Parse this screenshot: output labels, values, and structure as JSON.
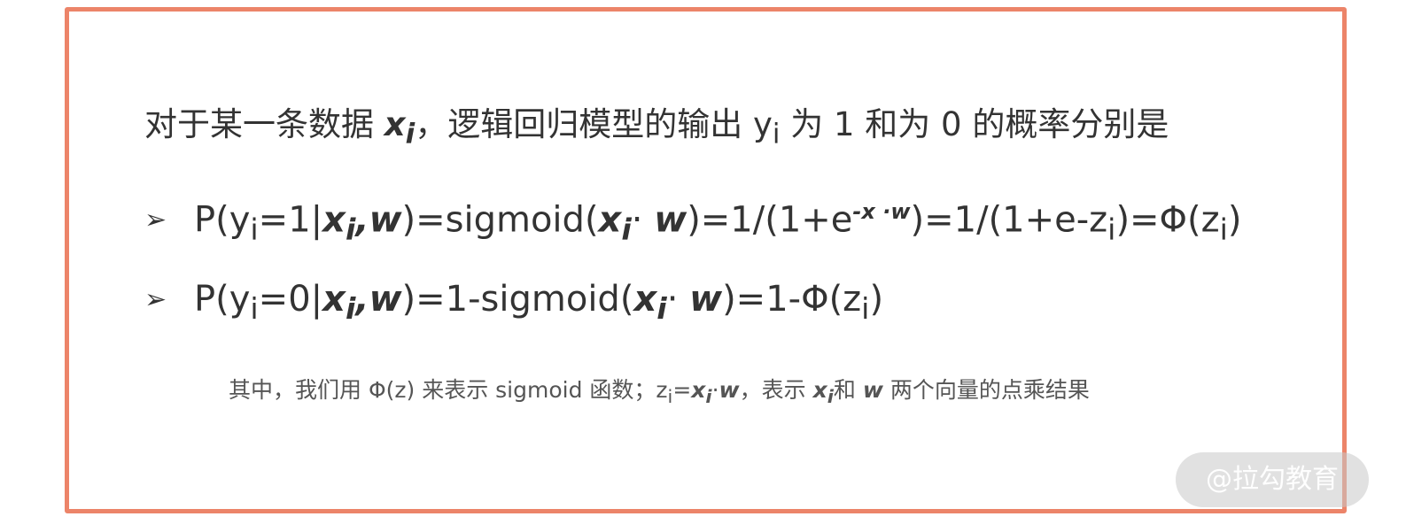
{
  "slide": {
    "border_color": "#ec8469",
    "heading": {
      "part1": "对于某一条数据 ",
      "x_var": "x",
      "x_sub": "i",
      "part2": "，逻辑回归模型的输出 y",
      "y_sub": "i",
      "part3": " 为 1 和为 0 的概率分别是"
    },
    "bullet_icon": "arrow-bullet-icon",
    "bullet_symbol": "➢",
    "formula1": {
      "p_open": "P(y",
      "y_sub": "i",
      "cond": "=1|",
      "x_var": "x",
      "x_sub": "i",
      "comma": ",",
      "w_var": "w",
      "sig_open": ")=sigmoid(",
      "x_var2": "x",
      "x_sub2": "i",
      "dot": "· ",
      "w_var2": "w",
      "eq_frac": ")=1/(1+e",
      "exp": "-x ·w",
      "mid": ")=1/(1+e-z",
      "z_sub": "i",
      "phi": ")=Φ(z",
      "z_sub2": "i",
      "close": ")"
    },
    "formula2": {
      "p_open": "P(y",
      "y_sub": "i",
      "cond": "=0|",
      "x_var": "x",
      "x_sub": "i",
      "comma": ",",
      "w_var": "w",
      "sig_open": ")=1-sigmoid(",
      "x_var2": "x",
      "x_sub2": "i",
      "dot": "· ",
      "w_var2": "w",
      "phi": ")=1-Φ(z",
      "z_sub": "i",
      "close": ")"
    },
    "note": {
      "part1": "其中，我们用 Φ(z) 来表示 sigmoid 函数；z",
      "z_sub": "i",
      "eq": "=",
      "x_var": "x",
      "x_sub": "i",
      "dot": "·",
      "w_var": "w",
      "part2": "，表示 ",
      "x_var2": "x",
      "x_sub2": "i",
      "part3": "和 ",
      "w_var2": "w",
      "part4": " 两个向量的点乘结果"
    }
  },
  "watermark": {
    "text": "@拉勾教育"
  }
}
